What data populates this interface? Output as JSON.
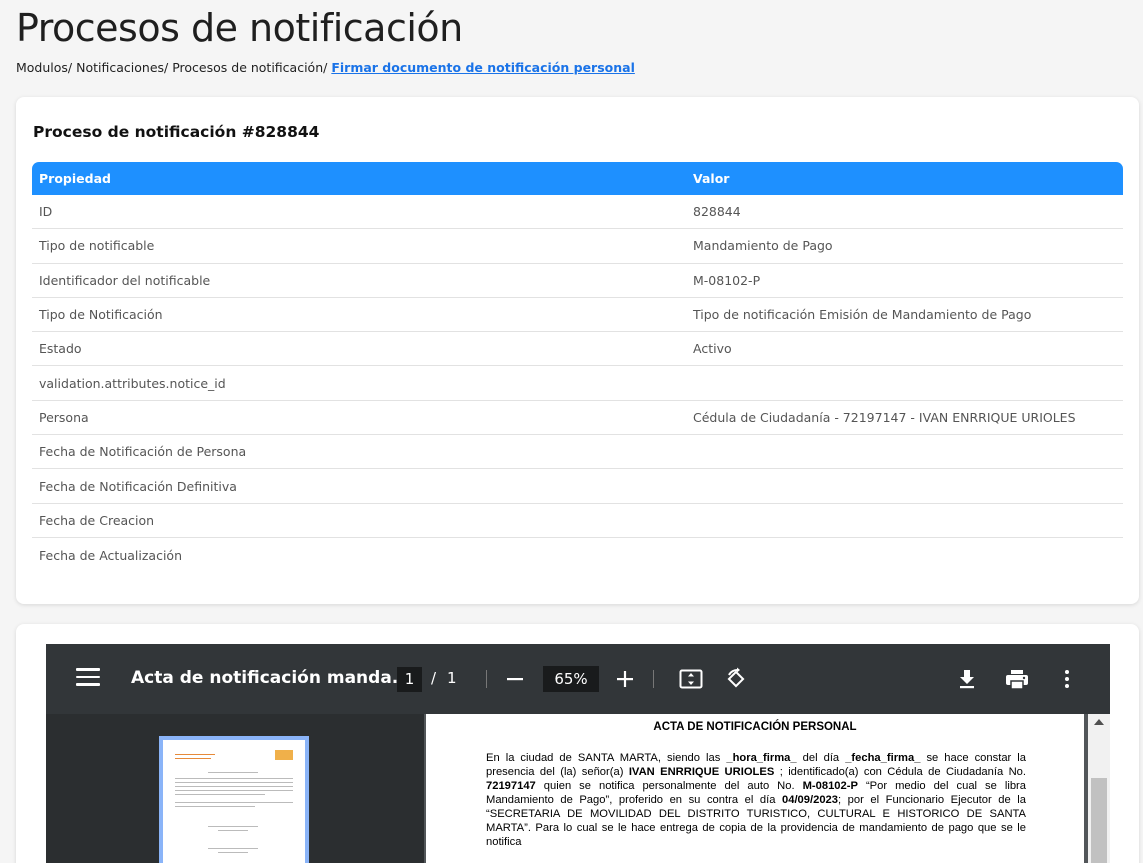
{
  "page": {
    "title": "Procesos de notificación"
  },
  "breadcrumb": {
    "items": [
      "Modulos/",
      "Notificaciones/",
      "Procesos de notificación/"
    ],
    "current": "Firmar documento de notificación personal"
  },
  "process_card": {
    "title": "Proceso de notificación #828844",
    "headers": {
      "property": "Propiedad",
      "value": "Valor"
    },
    "rows": [
      {
        "property": "ID",
        "value": "828844"
      },
      {
        "property": "Tipo de notificable",
        "value": "Mandamiento de Pago"
      },
      {
        "property": "Identificador del notificable",
        "value": "M-08102-P"
      },
      {
        "property": "Tipo de Notificación",
        "value": "Tipo de notificación Emisión de Mandamiento de Pago"
      },
      {
        "property": "Estado",
        "value": "Activo"
      },
      {
        "property": "validation.attributes.notice_id",
        "value": ""
      },
      {
        "property": "Persona",
        "value": "Cédula de Ciudadanía - 72197147 - IVAN ENRRIQUE URIOLES"
      },
      {
        "property": "Fecha de Notificación de Persona",
        "value": ""
      },
      {
        "property": "Fecha de Notificación Definitiva",
        "value": ""
      },
      {
        "property": "Fecha de Creacion",
        "value": ""
      },
      {
        "property": "Fecha de Actualización",
        "value": ""
      }
    ]
  },
  "pdf_viewer": {
    "document_title": "Acta de notificación manda...",
    "current_page": "1",
    "page_separator": "/",
    "total_pages": "1",
    "zoom": "65%",
    "icons": {
      "menu": "menu-icon",
      "zoom_out": "minus-icon",
      "zoom_in": "plus-icon",
      "fit": "fit-to-page-icon",
      "rotate": "rotate-icon",
      "download": "download-icon",
      "print": "print-icon",
      "more": "more-vertical-icon"
    },
    "document": {
      "heading": "ACTA DE NOTIFICACIÓN PERSONAL",
      "p1": "En la ciudad de SANTA MARTA, siendo las ",
      "hora": "_hora_firma_",
      "p2": " del día ",
      "fecha": "_fecha_firma_",
      "p3": " se hace constar la presencia del (la) señor(a) ",
      "persona": "IVAN ENRRIQUE URIOLES",
      "p4": " ; identificado(a) con Cédula de Ciudadanía No. ",
      "cedula": "72197147",
      "p5": " quien se notifica personalmente del auto No. ",
      "auto": "M-08102-P",
      "p6": " “Por medio del cual se libra Mandamiento de Pago”, proferido en su contra el día ",
      "fecha_auto": "04/09/2023",
      "p7": "; por el Funcionario Ejecutor de la “SECRETARIA DE MOVILIDAD DEL DISTRITO TURISTICO, CULTURAL E HISTORICO DE SANTA MARTA”. Para lo cual se le hace entrega de copia de la providencia de mandamiento de pago que se le notifica"
    }
  },
  "colors": {
    "table_header": "#1e90ff",
    "link": "#1a73e8",
    "viewer_toolbar": "#323639"
  }
}
